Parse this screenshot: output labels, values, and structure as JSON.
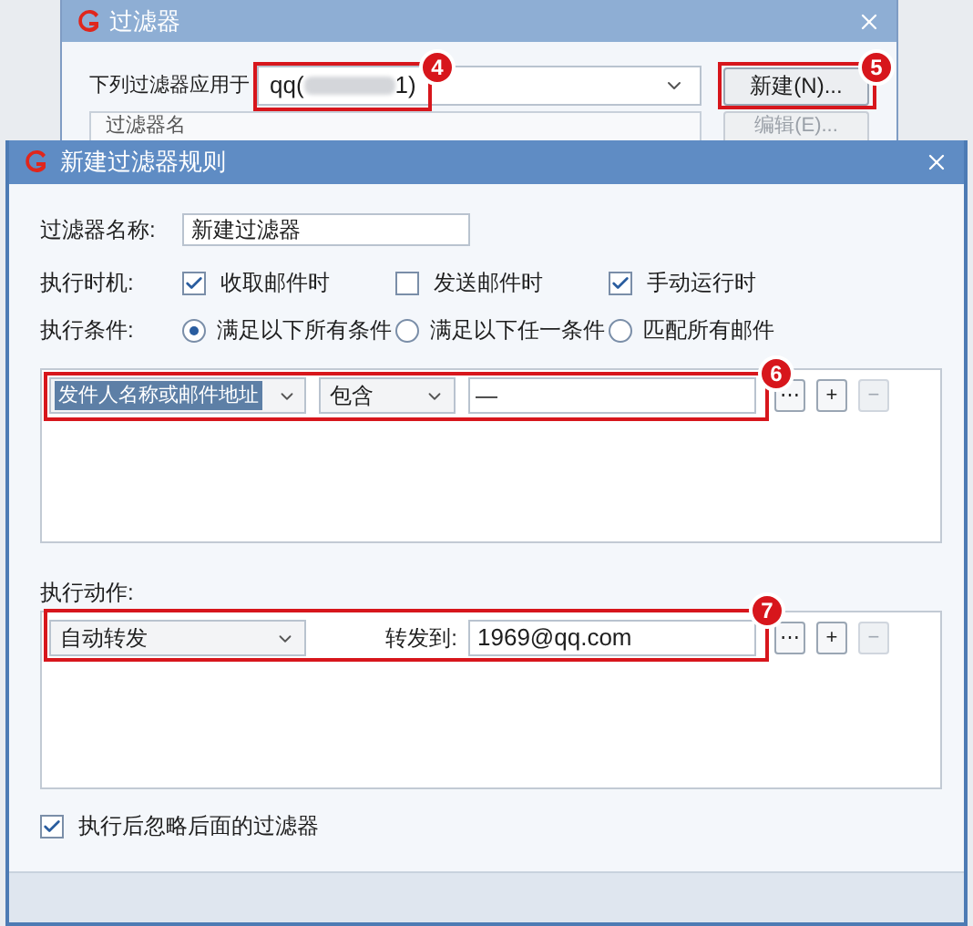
{
  "back_dialog": {
    "title": "过滤器",
    "apply_label": "下列过滤器应用于",
    "account_prefix": "qq(",
    "account_suffix": "1)",
    "new_button": "新建(N)...",
    "list_header": "过滤器名",
    "edit_button": {
      "label": "编辑(E)...",
      "disabled": true
    }
  },
  "dialog": {
    "title": "新建过滤器规则",
    "name_label": "过滤器名称:",
    "name_value": "新建过滤器",
    "timing_label": "执行时机:",
    "timing": [
      {
        "label": "收取邮件时",
        "checked": true
      },
      {
        "label": "发送邮件时",
        "checked": false
      },
      {
        "label": "手动运行时",
        "checked": true
      }
    ],
    "condition_label": "执行条件:",
    "condition_modes": [
      {
        "label": "满足以下所有条件",
        "selected": true
      },
      {
        "label": "满足以下任一条件",
        "selected": false
      },
      {
        "label": "匹配所有邮件",
        "selected": false
      }
    ],
    "conditions": [
      {
        "field": "发件人名称或邮件地址",
        "field_selected": true,
        "operator": "包含",
        "value": "—",
        "buttons": [
          {
            "label": "⋯",
            "disabled": false
          },
          {
            "label": "+",
            "disabled": false
          },
          {
            "label": "−",
            "disabled": true
          }
        ]
      }
    ],
    "actions_label": "执行动作:",
    "actions": [
      {
        "action": "自动转发",
        "target_label": "转发到:",
        "target": "1969@qq.com",
        "buttons": [
          {
            "label": "⋯",
            "disabled": false
          },
          {
            "label": "+",
            "disabled": false
          },
          {
            "label": "−",
            "disabled": true
          }
        ]
      }
    ],
    "skip_rest": {
      "label": "执行后忽略后面的过滤器",
      "checked": true
    }
  },
  "callouts": [
    {
      "number": "4"
    },
    {
      "number": "5"
    },
    {
      "number": "6"
    },
    {
      "number": "7"
    }
  ]
}
